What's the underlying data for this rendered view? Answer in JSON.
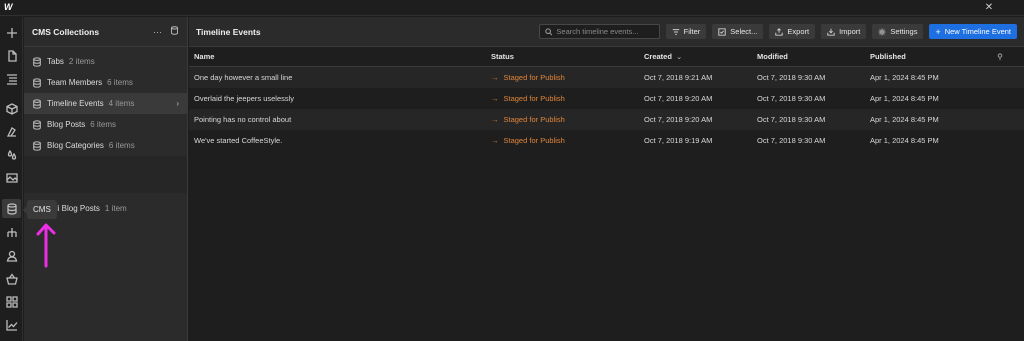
{
  "app": {
    "logo_glyph": "W"
  },
  "rail": {
    "icons": [
      "plus-icon",
      "page-icon",
      "navigator-icon",
      "cube-icon",
      "style-icon",
      "droplets-icon",
      "image-icon",
      "database-icon",
      "hierarchy-icon",
      "user-icon",
      "basket-icon",
      "apps-icon",
      "chart-icon"
    ]
  },
  "tooltip": {
    "text": "CMS"
  },
  "collections": {
    "title": "CMS Collections",
    "menu_glyph": "···",
    "items": [
      {
        "label": "Tabs",
        "count": "2 items"
      },
      {
        "label": "Team Members",
        "count": "6 items"
      },
      {
        "label": "Timeline Events",
        "count": "4 items"
      },
      {
        "label": "Blog Posts",
        "count": "6 items"
      },
      {
        "label": "Blog Categories",
        "count": "6 items"
      }
    ],
    "lone_item": {
      "label": "anli Blog Posts",
      "count": "1 item"
    }
  },
  "main": {
    "title": "Timeline Events",
    "search_placeholder": "Search timeline events...",
    "buttons": {
      "filter": "Filter",
      "select": "Select...",
      "export": "Export",
      "import": "Import",
      "settings": "Settings",
      "new": "New Timeline Event"
    },
    "columns": {
      "name": "Name",
      "status": "Status",
      "created": "Created",
      "modified": "Modified",
      "published": "Published"
    },
    "rows": [
      {
        "name": "One day however a small line",
        "status": "Staged for Publish",
        "created": "Oct 7, 2018 9:21 AM",
        "modified": "Oct 7, 2018 9:30 AM",
        "published": "Apr 1, 2024 8:45 PM"
      },
      {
        "name": "Overlaid the jeepers uselessly",
        "status": "Staged for Publish",
        "created": "Oct 7, 2018 9:20 AM",
        "modified": "Oct 7, 2018 9:30 AM",
        "published": "Apr 1, 2024 8:45 PM"
      },
      {
        "name": "Pointing has no control about",
        "status": "Staged for Publish",
        "created": "Oct 7, 2018 9:20 AM",
        "modified": "Oct 7, 2018 9:30 AM",
        "published": "Apr 1, 2024 8:45 PM"
      },
      {
        "name": "We've started CoffeeStyle.",
        "status": "Staged for Publish",
        "created": "Oct 7, 2018 9:19 AM",
        "modified": "Oct 7, 2018 9:30 AM",
        "published": "Apr 1, 2024 8:45 PM"
      }
    ]
  },
  "colors": {
    "accent": "#1d6fe2",
    "staged": "#e0853a",
    "annotation": "#ee2ee6"
  }
}
